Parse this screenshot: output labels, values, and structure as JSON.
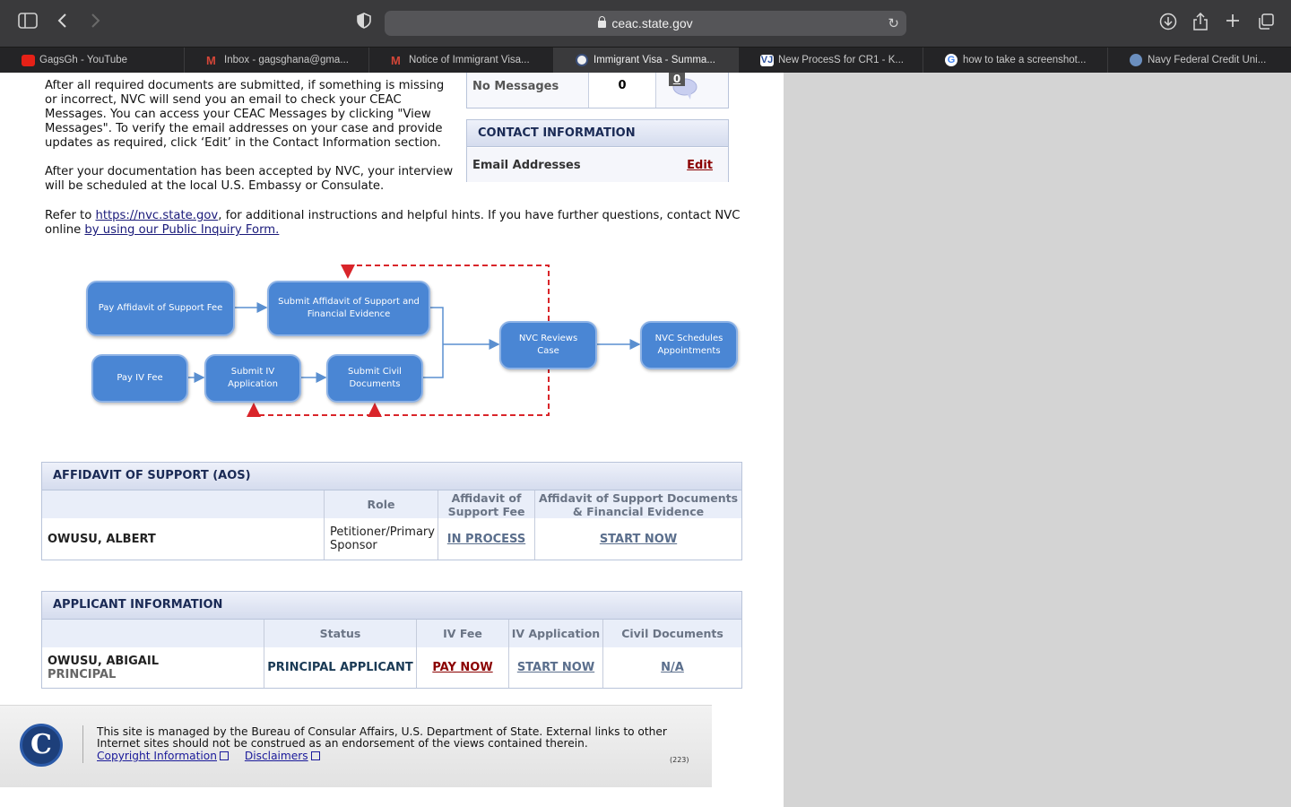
{
  "browser": {
    "url": "ceac.state.gov",
    "tabs": [
      {
        "label": "GagsGh - YouTube",
        "color": "#e62117"
      },
      {
        "label": "Inbox - gagsghana@gma...",
        "color": "#d44638"
      },
      {
        "label": "Notice of Immigrant Visa...",
        "color": "#d44638"
      },
      {
        "label": "Immigrant Visa - Summa...",
        "color": "#3b4f7a"
      },
      {
        "label": "New ProcesS for CR1 - K...",
        "color": "#2a4f9c"
      },
      {
        "label": "how to take a screenshot...",
        "color": "#4285f4"
      },
      {
        "label": "Navy Federal Credit Uni...",
        "color": "#6b8fbf"
      }
    ],
    "active_tab": 3
  },
  "intro": {
    "p1": "After all required documents are submitted, if something is missing or incorrect, NVC will send you an email to check your CEAC Messages. You can access your CEAC Messages by clicking \"View Messages\". To verify the email addresses on your case and provide updates as required, click ‘Edit’ in the Contact Information section.",
    "p2": "After your documentation has been accepted by NVC, your interview will be scheduled at the local U.S. Embassy or Consulate.",
    "p3_pre": "Refer to ",
    "p3_link": "https://nvc.state.gov",
    "p3_mid": ", for additional instructions and helpful hints. If you have further questions, contact NVC online ",
    "p3_link2": "by using our Public Inquiry Form."
  },
  "messages": {
    "label": "No Messages",
    "count": "0",
    "badge": "0"
  },
  "contact": {
    "title": "CONTACT INFORMATION",
    "email_label": "Email Addresses",
    "edit": "Edit"
  },
  "flow": {
    "pay_aos_fee": "Pay Affidavit of Support Fee",
    "submit_aos": "Submit Affidavit of Support and Financial Evidence",
    "pay_iv_fee": "Pay IV Fee",
    "submit_iv": "Submit IV Application",
    "submit_civil": "Submit Civil Documents",
    "nvc_reviews": "NVC Reviews Case",
    "nvc_schedules": "NVC Schedules Appointments"
  },
  "aos": {
    "title": "AFFIDAVIT OF SUPPORT (AOS)",
    "col_role": "Role",
    "col_fee": "Affidavit of Support Fee",
    "col_docs": "Affidavit of Support Documents & Financial Evidence",
    "name": "OWUSU, ALBERT",
    "role": "Petitioner/Primary Sponsor",
    "fee_status": "IN PROCESS",
    "docs_status": "START NOW"
  },
  "applicant": {
    "title": "APPLICANT INFORMATION",
    "col_status": "Status",
    "col_fee": "IV Fee",
    "col_app": "IV Application",
    "col_civil": "Civil Documents",
    "name": "OWUSU, ABIGAIL",
    "sub": "PRINCIPAL",
    "status": "PRINCIPAL APPLICANT",
    "fee": "PAY NOW",
    "app": "START NOW",
    "civil": "N/A"
  },
  "footer": {
    "seal_letter": "C",
    "text": "This site is managed by the Bureau of Consular Affairs, U.S. Department of State. External links to other Internet sites should not be construed as an endorsement of the views contained therein.",
    "copyright": "Copyright Information",
    "disclaimers": "Disclaimers",
    "code": "(223)"
  },
  "colors": {
    "node_fill": "#4a86d4",
    "dashed_line": "#d9252a",
    "arrow": "#5a8fd0"
  }
}
